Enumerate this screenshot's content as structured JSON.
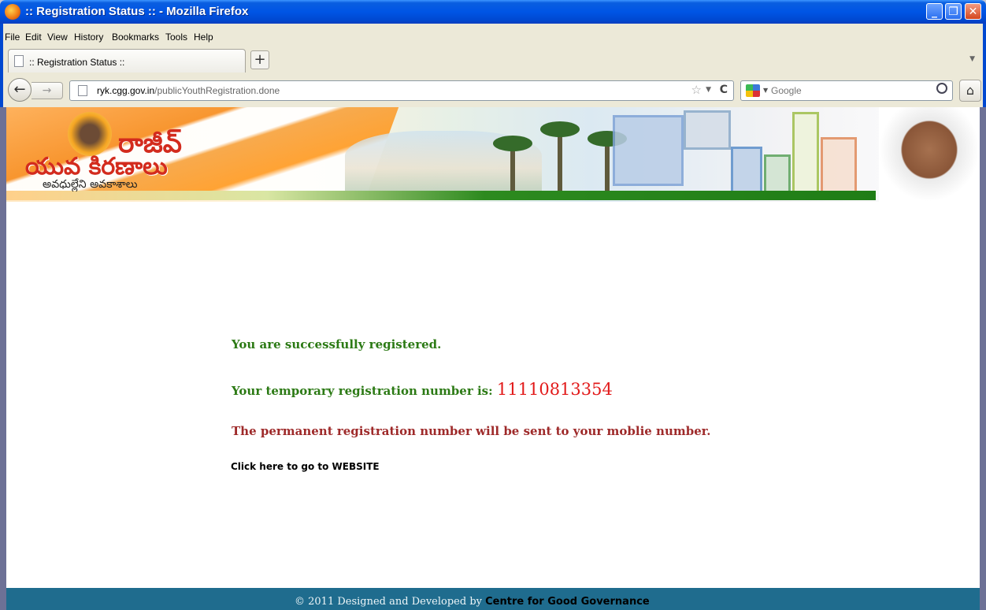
{
  "window": {
    "title": ":: Registration Status :: - Mozilla Firefox"
  },
  "menu": [
    "File",
    "Edit",
    "View",
    "History",
    "Bookmarks",
    "Tools",
    "Help"
  ],
  "tabs": [
    {
      "label": ":: Registration Status ::"
    }
  ],
  "nav": {
    "url_host": "ryk.cgg.gov.in",
    "url_path": "/publicYouthRegistration.done",
    "search_placeholder": "Google"
  },
  "banner": {
    "logo_line1": "రాజీవ్",
    "logo_line2": "యువ కిరణాలు",
    "logo_line3": "అవధుల్లేని అవకాశాలు"
  },
  "content": {
    "success_message": "You are successfully registered.",
    "temp_label": "Your temporary registration number is:",
    "temp_number": "11110813354",
    "permanent_message": "The permanent registration number will be sent to your moblie number.",
    "website_link": "Click here to go to WEBSITE"
  },
  "footer": {
    "copyright": "©  2011 Designed and Developed by",
    "org": "Centre for Good Governance"
  },
  "colors": {
    "success_green": "#2c7a15",
    "number_red": "#e21a1a",
    "notice_maroon": "#9e2a2a",
    "footer_blue": "#1f6c8e",
    "titlebar_blue": "#0055e5"
  }
}
